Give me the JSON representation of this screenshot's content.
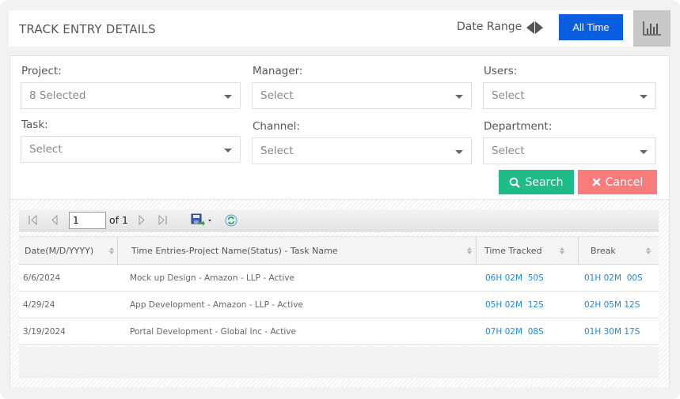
{
  "header": {
    "title": "TRACK ENTRY DETAILS",
    "date_range_label": "Date Range",
    "all_time_label": "All Time",
    "chart_icon": "bar-chart-icon",
    "accent_color": "#0a5ee0"
  },
  "filters": {
    "project": {
      "label": "Project:",
      "value": "8 Selected"
    },
    "manager": {
      "label": "Manager:",
      "value": "Select"
    },
    "users": {
      "label": "Users:",
      "value": "Select"
    },
    "task": {
      "label": "Task:",
      "value": "Select"
    },
    "channel": {
      "label": "Channel:",
      "value": "Select"
    },
    "department": {
      "label": "Department:",
      "value": "Select"
    }
  },
  "actions": {
    "search_label": "Search",
    "cancel_label": "Cancel",
    "search_color": "#1fbc8a",
    "cancel_color": "#f87c7c"
  },
  "pager": {
    "current_page": "1",
    "of_label": "of 1"
  },
  "table": {
    "columns": [
      "Date(M/D/YYYY)",
      "Time Entries-Project Name(Status) - Task Name",
      "Time Tracked",
      "Break"
    ],
    "rows": [
      {
        "date": "6/6/2024",
        "entry": "Mock up Design - Amazon - LLP - Active",
        "tracked": "06H 02M  50S",
        "break": "01H 02M  00S"
      },
      {
        "date": "4/29/24",
        "entry": "App Development - Amazon - LLP - Active",
        "tracked": "05H 02M  12S",
        "break": "02H 05M 12S"
      },
      {
        "date": "3/19/2024",
        "entry": "Portal Development - Global Inc - Active",
        "tracked": "07H 02M  08S",
        "break": "01H 30M 17S"
      }
    ]
  }
}
